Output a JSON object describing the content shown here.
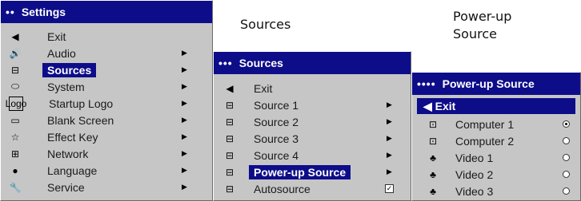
{
  "settings_menu": {
    "title": "Settings",
    "title_dots": "••",
    "items": [
      {
        "icon": "left-arrow-icon",
        "glyph": "◀",
        "label": "Exit",
        "arrow": false,
        "selected": false
      },
      {
        "icon": "speaker-icon",
        "glyph": "🔊",
        "label": "Audio",
        "arrow": true,
        "selected": false
      },
      {
        "icon": "source-input-icon",
        "glyph": "⊟",
        "label": "Sources",
        "arrow": true,
        "selected": true
      },
      {
        "icon": "system-icon",
        "glyph": "⬭",
        "label": "System",
        "arrow": true,
        "selected": false
      },
      {
        "icon": "logo-icon",
        "glyph": "Logo",
        "label": "Startup Logo",
        "arrow": true,
        "selected": false
      },
      {
        "icon": "blank-screen-icon",
        "glyph": "▭",
        "label": "Blank Screen",
        "arrow": true,
        "selected": false
      },
      {
        "icon": "star-icon",
        "glyph": "☆",
        "label": "Effect Key",
        "arrow": true,
        "selected": false
      },
      {
        "icon": "network-icon",
        "glyph": "⊞",
        "label": "Network",
        "arrow": true,
        "selected": false
      },
      {
        "icon": "globe-icon",
        "glyph": "●",
        "label": "Language",
        "arrow": true,
        "selected": false
      },
      {
        "icon": "wrench-icon",
        "glyph": "🔧",
        "label": "Service",
        "arrow": true,
        "selected": false
      }
    ]
  },
  "sources_menu": {
    "caption": "Sources",
    "title": "Sources",
    "title_dots": "•••",
    "items": [
      {
        "icon": "left-arrow-icon",
        "glyph": "◀",
        "label": "Exit",
        "arrow": false,
        "selected": false,
        "check": false
      },
      {
        "icon": "source-input-icon",
        "glyph": "⊟",
        "label": "Source 1",
        "arrow": true,
        "selected": false,
        "check": false
      },
      {
        "icon": "source-input-icon",
        "glyph": "⊟",
        "label": "Source 2",
        "arrow": true,
        "selected": false,
        "check": false
      },
      {
        "icon": "source-input-icon",
        "glyph": "⊟",
        "label": "Source 3",
        "arrow": true,
        "selected": false,
        "check": false
      },
      {
        "icon": "source-input-icon",
        "glyph": "⊟",
        "label": "Source 4",
        "arrow": true,
        "selected": false,
        "check": false
      },
      {
        "icon": "power-up-source-icon",
        "glyph": "⊟",
        "label": "Power-up Source",
        "arrow": true,
        "selected": true,
        "check": false
      },
      {
        "icon": "autosource-icon",
        "glyph": "⊟",
        "label": "Autosource",
        "arrow": false,
        "selected": false,
        "check": true
      }
    ]
  },
  "powerup_menu": {
    "caption_line1": "Power-up",
    "caption_line2": "Source",
    "title": "Power-up Source",
    "title_dots": "••••",
    "exit_label": "◀ Exit",
    "items": [
      {
        "icon": "computer-icon",
        "glyph": "⊡",
        "label": "Computer 1",
        "selected": true
      },
      {
        "icon": "computer-icon",
        "glyph": "⊡",
        "label": "Computer 2",
        "selected": false
      },
      {
        "icon": "video-icon",
        "glyph": "♣",
        "label": "Video 1",
        "selected": false
      },
      {
        "icon": "video-icon",
        "glyph": "♣",
        "label": "Video 2",
        "selected": false
      },
      {
        "icon": "video-icon",
        "glyph": "♣",
        "label": "Video 3",
        "selected": false
      }
    ]
  }
}
